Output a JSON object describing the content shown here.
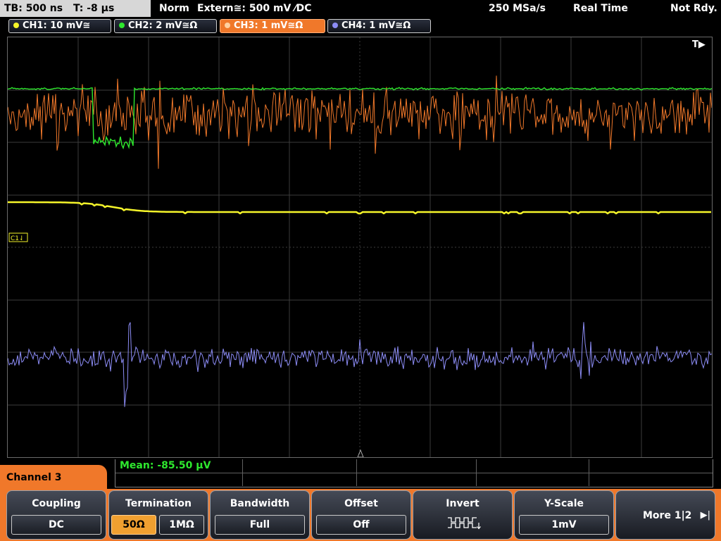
{
  "status": {
    "timebase": "TB: 500 ns",
    "trigger_pos": "T: -8 µs",
    "mode": "Norm",
    "trigger": "Extern≅: 500 mV ⁄DC",
    "sample_rate": "250 MSa/s",
    "acq": "Real Time",
    "state": "Not Rdy."
  },
  "channels": [
    {
      "label": "CH1: 10 mV≅",
      "color": "#f5f52a"
    },
    {
      "label": "CH2: 2 mV≅Ω",
      "color": "#2ee82e"
    },
    {
      "label": "CH3: 1 mV≅Ω",
      "color": "#f0782a",
      "active": true
    },
    {
      "label": "CH4: 1 mV≅Ω",
      "color": "#8c8cf5"
    }
  ],
  "markers": {
    "trigger_flag": "T▶",
    "ch1_ref": "C1⇃"
  },
  "panel": {
    "title": "Channel 3"
  },
  "measurement": {
    "mean": "Mean: -85.50 µV"
  },
  "softkeys": {
    "coupling": {
      "title": "Coupling",
      "value": "DC"
    },
    "termination": {
      "title": "Termination",
      "opt_a": "50Ω",
      "opt_b": "1MΩ"
    },
    "bandwidth": {
      "title": "Bandwidth",
      "value": "Full"
    },
    "offset": {
      "title": "Offset",
      "value": "Off"
    },
    "invert": {
      "title": "Invert",
      "icon": "invert-waveform-icon"
    },
    "yscale": {
      "title": "Y-Scale",
      "value": "1mV"
    },
    "more": {
      "label": "More 1|2"
    }
  },
  "colors": {
    "accent": "#f0782a",
    "grid": "#3c3c3c",
    "ch1": "#f5f52a",
    "ch2": "#2ee82e",
    "ch3": "#f0782a",
    "ch4": "#8c8cf5"
  }
}
